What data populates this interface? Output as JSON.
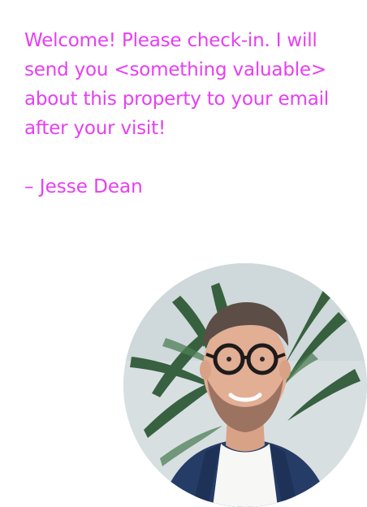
{
  "message": {
    "lines": [
      "Welcome! Please check-in. I will",
      "send you <something valuable>",
      "about this property to your email",
      "after your visit!"
    ]
  },
  "signature": "– Jesse Dean",
  "colors": {
    "accent": "#e63ff2",
    "background": "#ffffff"
  },
  "avatar": {
    "icon": "person-photo-icon"
  }
}
